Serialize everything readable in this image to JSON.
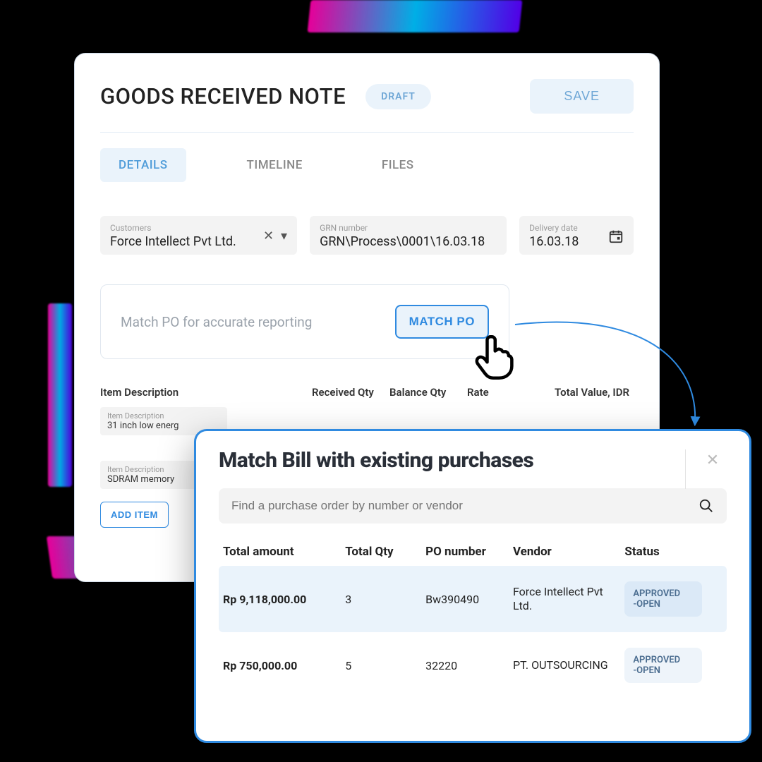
{
  "header": {
    "title": "GOODS RECEIVED NOTE",
    "badge": "DRAFT",
    "save_label": "SAVE"
  },
  "tabs": {
    "details": "DETAILS",
    "timeline": "TIMELINE",
    "files": "FILES"
  },
  "fields": {
    "customers": {
      "label": "Customers",
      "value": "Force Intellect Pvt Ltd."
    },
    "grn": {
      "label": "GRN number",
      "value": "GRN\\Process\\0001\\16.03.18"
    },
    "date": {
      "label": "Delivery date",
      "value": "16.03.18"
    }
  },
  "match": {
    "hint": "Match PO for accurate reporting",
    "button": "MATCH PO"
  },
  "table": {
    "headers": [
      "Item Description",
      "Received Qty",
      "Balance Qty",
      "Rate",
      "Total Value, IDR"
    ],
    "item_label": "Item Description",
    "rows": [
      {
        "desc": "31 inch low energ"
      },
      {
        "desc": "SDRAM memory"
      }
    ],
    "add_item": "ADD ITEM"
  },
  "modal": {
    "title": "Match Bill with existing purchases",
    "search_placeholder": "Find a purchase order by number or vendor",
    "headers": [
      "Total amount",
      "Total Qty",
      "PO number",
      "Vendor",
      "Status"
    ],
    "rows": [
      {
        "amount": "Rp 9,118,000.00",
        "qty": "3",
        "po": "Bw390490",
        "vendor": "Force Intellect Pvt Ltd.",
        "status": "APPROVED\n-OPEN",
        "selected": true
      },
      {
        "amount": "Rp 750,000.00",
        "qty": "5",
        "po": "32220",
        "vendor": "PT. OUTSOURCING",
        "status": "APPROVED\n-OPEN",
        "selected": false
      }
    ]
  }
}
